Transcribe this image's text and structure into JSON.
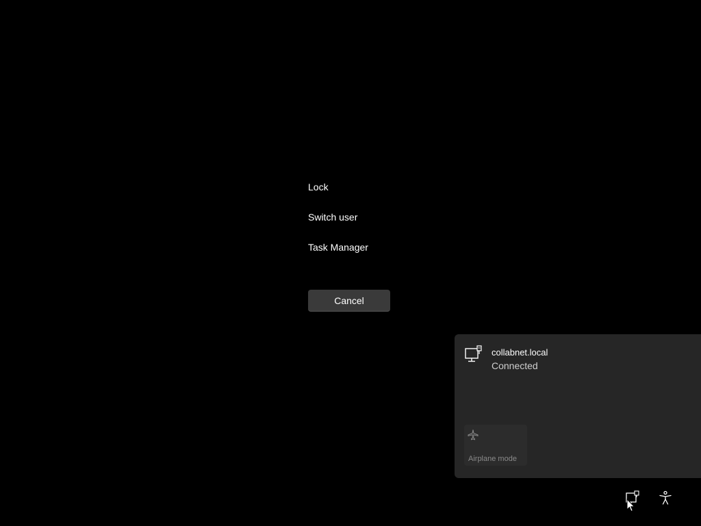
{
  "security_menu": {
    "lock_label": "Lock",
    "switch_user_label": "Switch user",
    "task_manager_label": "Task Manager",
    "cancel_label": "Cancel"
  },
  "network_flyout": {
    "network_name": "collabnet.local",
    "network_status": "Connected",
    "network_icon": "wired-network-icon",
    "airplane_mode_label": "Airplane mode",
    "airplane_icon": "airplane-icon"
  },
  "system_tray": {
    "network_icon": "network-icon",
    "accessibility_icon": "accessibility-icon"
  },
  "colors": {
    "background": "#000000",
    "button_bg": "#3a3a3a",
    "flyout_bg": "#262626",
    "tile_bg": "#2c2c2c",
    "text_primary": "#ffffff",
    "text_secondary": "#cfcfcf",
    "text_disabled": "#8a8a8a"
  }
}
